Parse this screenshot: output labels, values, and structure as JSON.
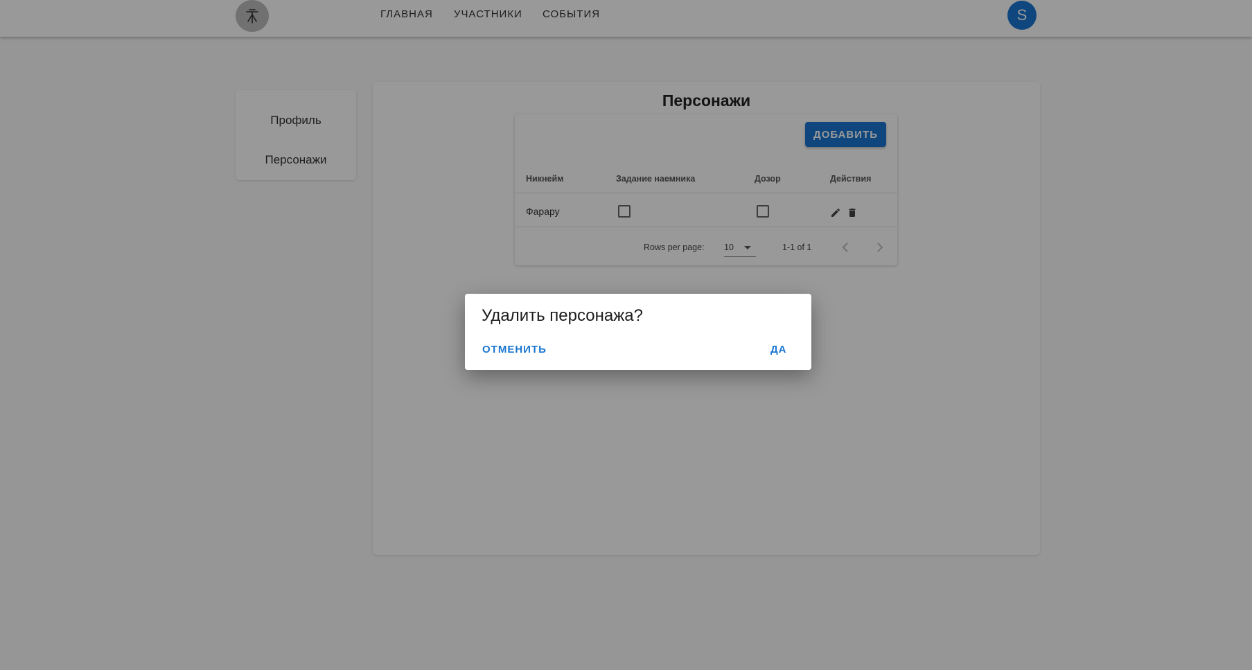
{
  "nav": {
    "items": [
      {
        "label": "ГЛАВНАЯ"
      },
      {
        "label": "УЧАСТНИКИ"
      },
      {
        "label": "СОБЫТИЯ"
      }
    ],
    "avatar_letter": "S"
  },
  "sidebar": {
    "items": [
      {
        "label": "Профиль"
      },
      {
        "label": "Персонажи"
      }
    ]
  },
  "main": {
    "title": "Персонажи",
    "add_button": "ДОБАВИТЬ",
    "columns": [
      "Никнейм",
      "Задание наемника",
      "Дозор",
      "Действия"
    ],
    "rows": [
      {
        "nickname": "Фарару",
        "mercenary_task": false,
        "patrol": false
      }
    ],
    "pagination": {
      "rows_per_page_label": "Rows per page:",
      "rows_per_page_value": "10",
      "range": "1-1 of 1"
    }
  },
  "dialog": {
    "title": "Удалить персонажа?",
    "cancel": "ОТМЕНИТЬ",
    "confirm": "ДА"
  },
  "colors": {
    "primary": "#1976d2"
  }
}
